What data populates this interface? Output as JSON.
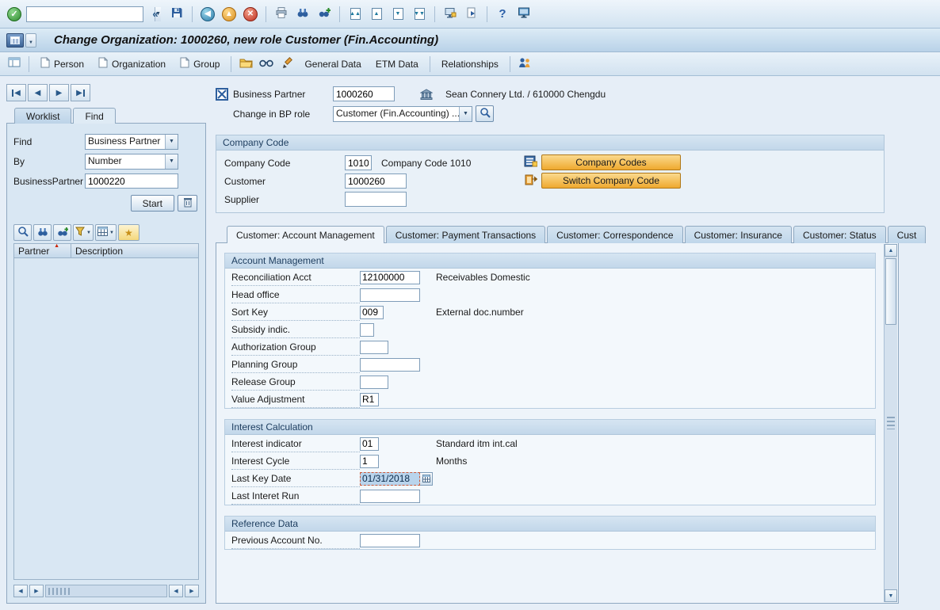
{
  "glyphs": {
    "check": "✓",
    "collapse": "«",
    "dropdown": "▼",
    "back": "◀",
    "exit": "▲",
    "cancel": "✕",
    "help": "?",
    "left": "◀",
    "right": "▶",
    "up": "▲",
    "down": "▼",
    "star": "★",
    "sort": "▲",
    "page_up2": "▲▲",
    "page_up": "▲",
    "page_down": "▼",
    "page_down2": "▼▼"
  },
  "system_toolbar": {
    "command_value": ""
  },
  "title_bar": {
    "title": "Change Organization: 1000260, new role Customer (Fin.Accounting)"
  },
  "app_toolbar": {
    "person": "Person",
    "organization": "Organization",
    "group": "Group",
    "general_data": "General Data",
    "etm_data": "ETM Data",
    "relationships": "Relationships"
  },
  "left_panel": {
    "tabs": {
      "worklist": "Worklist",
      "find": "Find"
    },
    "form": {
      "find_label": "Find",
      "find_value": "Business Partner",
      "by_label": "By",
      "by_value": "Number",
      "partner_label": "BusinessPartner",
      "partner_value": "1000220",
      "start_label": "Start"
    },
    "results": {
      "partner_col": "Partner",
      "description_col": "Description"
    }
  },
  "bp_header": {
    "bp_label": "Business Partner",
    "bp_value": "1000260",
    "bp_description": "Sean Connery Ltd. / 610000 Chengdu",
    "role_label": "Change in BP role",
    "role_value": "Customer (Fin.Accounting) ..."
  },
  "company_code": {
    "title": "Company Code",
    "rows": [
      {
        "label": "Company Code",
        "value": "1010",
        "note": "Company Code 1010"
      },
      {
        "label": "Customer",
        "value": "1000260",
        "note": ""
      },
      {
        "label": "Supplier",
        "value": "",
        "note": ""
      }
    ],
    "buttons": {
      "company_codes": "Company Codes",
      "switch_company_code": "Switch Company Code"
    }
  },
  "tabstrip": {
    "tabs": [
      {
        "label": "Customer: Account Management"
      },
      {
        "label": "Customer: Payment Transactions"
      },
      {
        "label": "Customer: Correspondence"
      },
      {
        "label": "Customer: Insurance"
      },
      {
        "label": "Customer: Status"
      },
      {
        "label": "Cust"
      }
    ]
  },
  "groups": [
    {
      "title": "Account Management",
      "fields": [
        {
          "label": "Reconciliation Acct",
          "value": "12100000",
          "note": "Receivables Domestic"
        },
        {
          "label": "Head office",
          "value": "",
          "note": ""
        },
        {
          "label": "Sort Key",
          "value": "009",
          "note": "External doc.number"
        },
        {
          "label": "Subsidy indic.",
          "value": "",
          "note": ""
        },
        {
          "label": "Authorization Group",
          "value": "",
          "note": ""
        },
        {
          "label": "Planning Group",
          "value": "",
          "note": ""
        },
        {
          "label": "Release Group",
          "value": "",
          "note": ""
        },
        {
          "label": "Value Adjustment",
          "value": "R1",
          "note": ""
        }
      ]
    },
    {
      "title": "Interest Calculation",
      "fields": [
        {
          "label": "Interest indicator",
          "value": "01",
          "note": "Standard itm int.cal"
        },
        {
          "label": "Interest Cycle",
          "value": "1",
          "note": "Months"
        },
        {
          "label": "Last Key Date",
          "value": "01/31/2018",
          "note": ""
        },
        {
          "label": "Last Interet Run",
          "value": "",
          "note": ""
        }
      ]
    },
    {
      "title": "Reference Data",
      "fields": [
        {
          "label": "Previous Account No.",
          "value": "",
          "note": ""
        }
      ]
    }
  ],
  "colors": {
    "accent_button": "#f0aa30",
    "selection_bg": "#b9d4ec",
    "focus_border": "#cc5a3a"
  }
}
